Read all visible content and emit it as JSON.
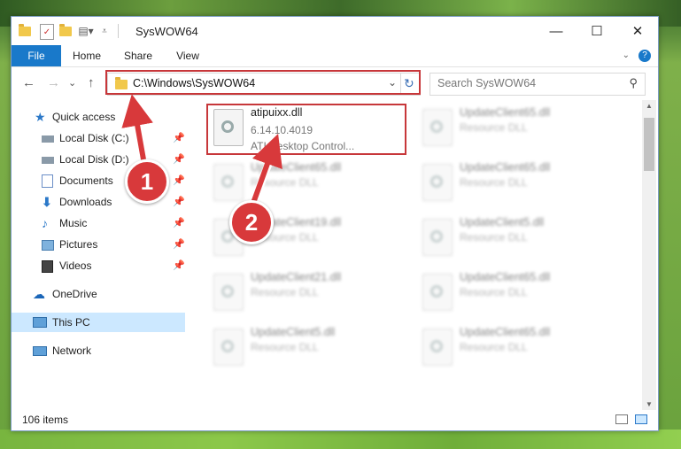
{
  "window": {
    "title": "SysWOW64",
    "minimize_glyph": "—",
    "maximize_glyph": "☐",
    "close_glyph": "✕"
  },
  "ribbon": {
    "tabs": [
      "File",
      "Home",
      "Share",
      "View"
    ],
    "help_glyph": "?"
  },
  "nav": {
    "back_glyph": "←",
    "forward_glyph": "→",
    "history_glyph": "⌄",
    "up_glyph": "↑",
    "address": "C:\\Windows\\SysWOW64",
    "address_dropdown_glyph": "⌄",
    "refresh_glyph": "↻",
    "search_placeholder": "Search SysWOW64",
    "search_glyph": "⚲"
  },
  "sidebar": {
    "items": [
      {
        "label": "Quick access",
        "icon": "star-icon"
      },
      {
        "label": "Local Disk (C:)",
        "icon": "drive-icon",
        "pinned": true
      },
      {
        "label": "Local Disk (D:)",
        "icon": "drive-icon",
        "pinned": true
      },
      {
        "label": "Documents",
        "icon": "documents-icon",
        "pinned": true
      },
      {
        "label": "Downloads",
        "icon": "download-icon",
        "pinned": true
      },
      {
        "label": "Music",
        "icon": "music-icon",
        "pinned": true
      },
      {
        "label": "Pictures",
        "icon": "pictures-icon",
        "pinned": true
      },
      {
        "label": "Videos",
        "icon": "videos-icon",
        "pinned": true
      },
      {
        "label": "OneDrive",
        "icon": "cloud-icon"
      },
      {
        "label": "This PC",
        "icon": "computer-icon",
        "selected": true
      },
      {
        "label": "Network",
        "icon": "network-icon"
      }
    ],
    "pin_glyph": "📌"
  },
  "files": {
    "highlighted": {
      "name": "atipuixx.dll",
      "version": "6.14.10.4019",
      "description": "ATI Desktop Control..."
    },
    "left_column": [
      {
        "name": "UpdateClient65.dll",
        "type": "Resource DLL"
      },
      {
        "name": "UpdateClient19.dll",
        "type": "Resource DLL"
      },
      {
        "name": "UpdateClient21.dll",
        "type": "Resource DLL"
      },
      {
        "name": "UpdateClient5.dll",
        "type": "Resource DLL"
      }
    ],
    "right_column": [
      {
        "name": "UpdateClient65.dll",
        "type": "Resource DLL"
      },
      {
        "name": "UpdateClient65.dll",
        "type": "Resource DLL"
      },
      {
        "name": "UpdateClient5.dll",
        "type": "Resource DLL"
      },
      {
        "name": "UpdateClient65.dll",
        "type": "Resource DLL"
      },
      {
        "name": "UpdateClient65.dll",
        "type": "Resource DLL"
      }
    ]
  },
  "status": {
    "item_count": "106 items"
  },
  "annotations": {
    "step1": "1",
    "step2": "2",
    "accent_color": "#d8393b"
  }
}
